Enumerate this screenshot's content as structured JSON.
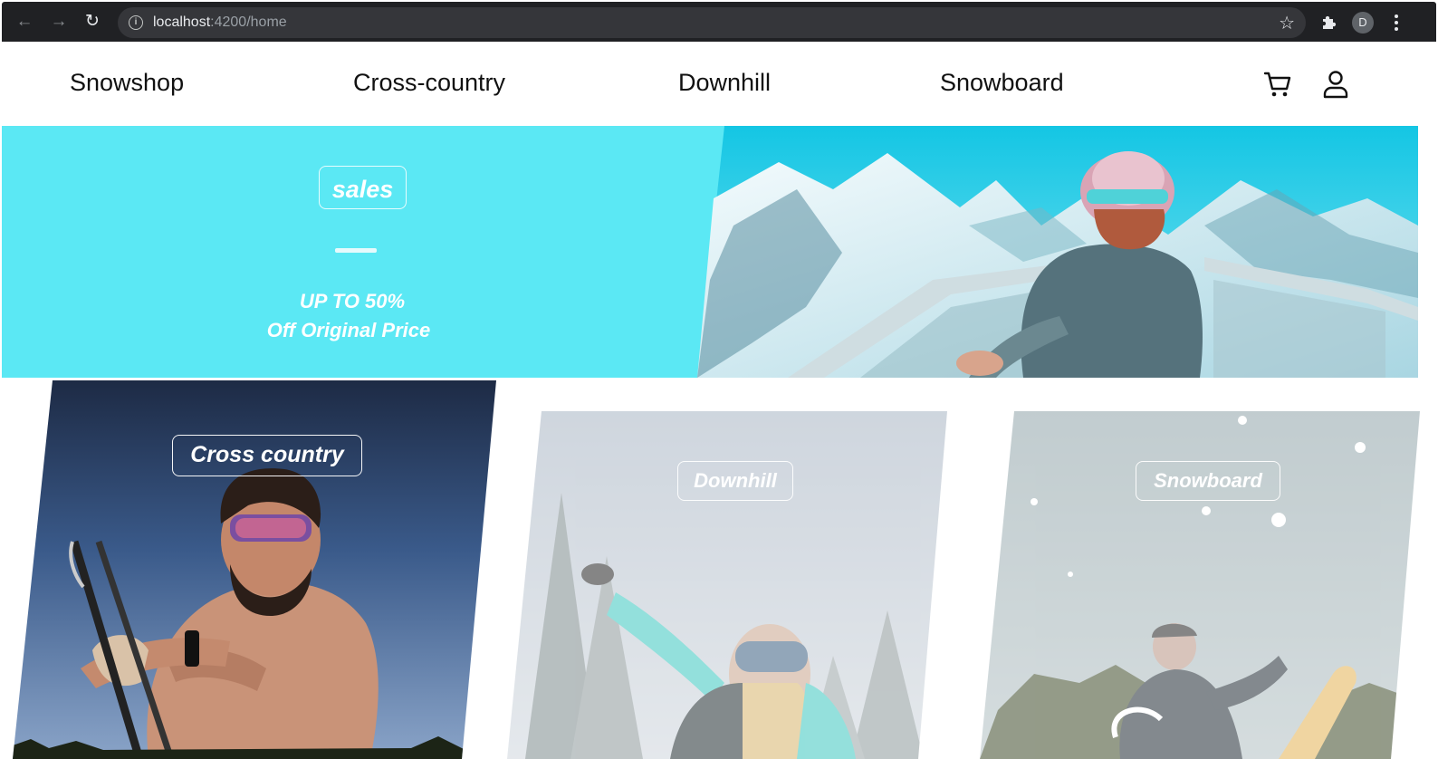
{
  "browser": {
    "url_host": "localhost",
    "url_path": ":4200/home",
    "profile_initial": "D"
  },
  "nav": {
    "brand": "Snowshop",
    "links": [
      "Cross-country",
      "Downhill",
      "Snowboard"
    ]
  },
  "hero": {
    "badge": "sales",
    "line1": "UP TO 50%",
    "line2": "Off Original Price",
    "background": "#5be8f4"
  },
  "categories": [
    {
      "label": "Cross country",
      "active": true
    },
    {
      "label": "Downhill",
      "active": false
    },
    {
      "label": "Snowboard",
      "active": false
    }
  ]
}
